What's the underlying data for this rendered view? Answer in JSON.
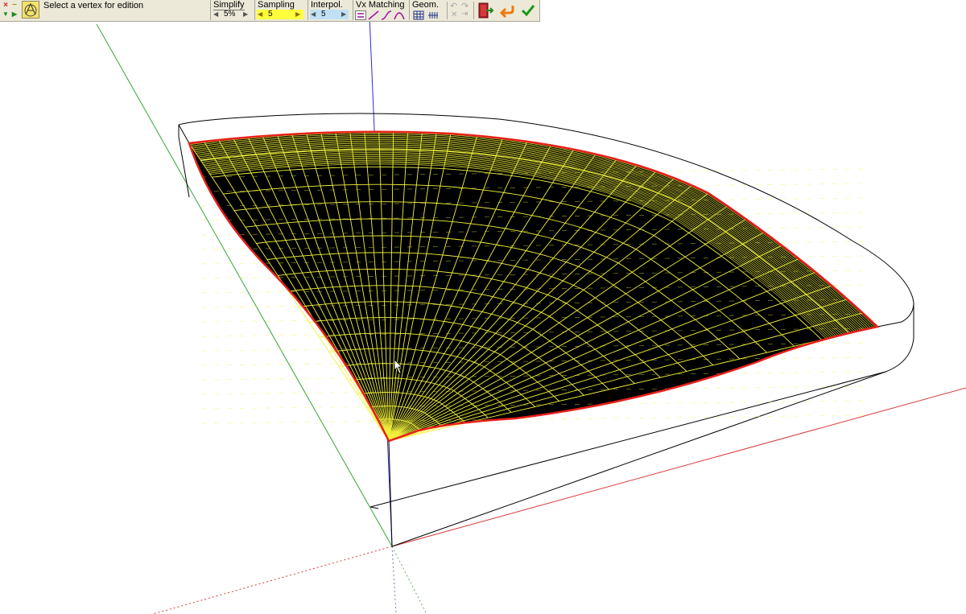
{
  "toolbar": {
    "status": "Select a vertex for edition",
    "simplify": {
      "label": "Simplify",
      "value": "5%"
    },
    "sampling": {
      "label": "Sampling",
      "value": "5"
    },
    "interpol": {
      "label": "Interpol.",
      "value": "5"
    },
    "vx_matching": {
      "label": "Vx Matching"
    },
    "geom": {
      "label": "Geom."
    }
  },
  "colors": {
    "mesh": "#f2f23c",
    "surface": "#000000",
    "border": "#e8201a",
    "axis_red": "#d93a3a",
    "axis_green": "#33a633",
    "axis_blue": "#2b2bd6",
    "sampling_highlight": "#ffff3c",
    "interpol_highlight": "#bfe0f5"
  }
}
